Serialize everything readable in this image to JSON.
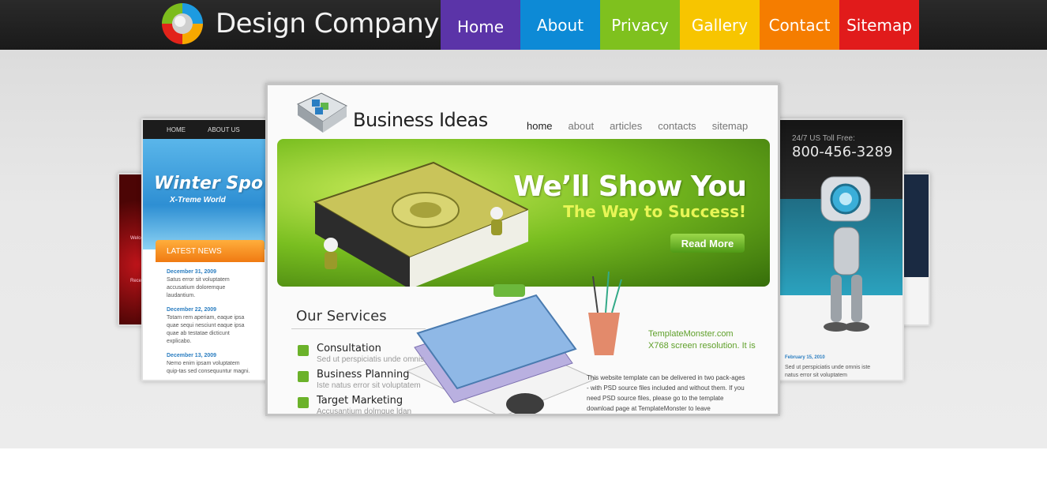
{
  "header": {
    "brand": "Design Company"
  },
  "nav": [
    {
      "label": "Home",
      "color": "#5b34a8",
      "active": true
    },
    {
      "label": "About",
      "color": "#0d8ad6"
    },
    {
      "label": "Privacy",
      "color": "#7fc11e"
    },
    {
      "label": "Gallery",
      "color": "#f7c500"
    },
    {
      "label": "Contact",
      "color": "#f57d00"
    },
    {
      "label": "Sitemap",
      "color": "#e11b1b"
    }
  ],
  "showcase": {
    "left_far": {
      "lines": [
        "Welco",
        "Rece"
      ]
    },
    "left_near": {
      "nav": [
        "HOME",
        "ABOUT US"
      ],
      "hero_title": "Winter Spo",
      "hero_subtitle": "X-Treme World",
      "news_title": "LATEST NEWS",
      "news": [
        {
          "date": "December 31, 2009",
          "text": "Satus error sit voluptatem accusatium doloremque laudantium."
        },
        {
          "date": "December 22, 2009",
          "text": "Totam rem aperiam, eaque ipsa quae sequi nesciunt eaque ipsa quae ab testatae dicticunt explicabo."
        },
        {
          "date": "December 13, 2009",
          "text": "Nemo enim ipsam voluptatem quip-tas sed consequuntur magni."
        }
      ]
    },
    "right_near": {
      "toll_label": "24/7 US Toll Free:",
      "phone": "800-456-3289",
      "date": "February 15, 2010",
      "text": "Sed ut perspiciatis unde omnis iste natus error sit voluptatem"
    },
    "main": {
      "title": "Business Ideas",
      "nav": [
        "home",
        "about",
        "articles",
        "contacts",
        "sitemap"
      ],
      "banner_heading": "We’ll Show You",
      "banner_subheading": "The Way to Success!",
      "read_more": "Read More",
      "services_title": "Our Services",
      "services": [
        {
          "name": "Consultation",
          "desc": "Sed ut perspiciatis unde omnis"
        },
        {
          "name": "Business Planning",
          "desc": "Iste natus error sit voluptatem"
        },
        {
          "name": "Target Marketing",
          "desc": "Accusantium dolmque ldan"
        }
      ],
      "promo_line1": "TemplateMonster.com",
      "promo_line2": "X768 screen resolution. It is",
      "body_text": "This website template can be delivered in two pack-ages - with PSD source files included and without them. If you need PSD source files, please go to the template download page at TemplateMonster to leave"
    }
  }
}
